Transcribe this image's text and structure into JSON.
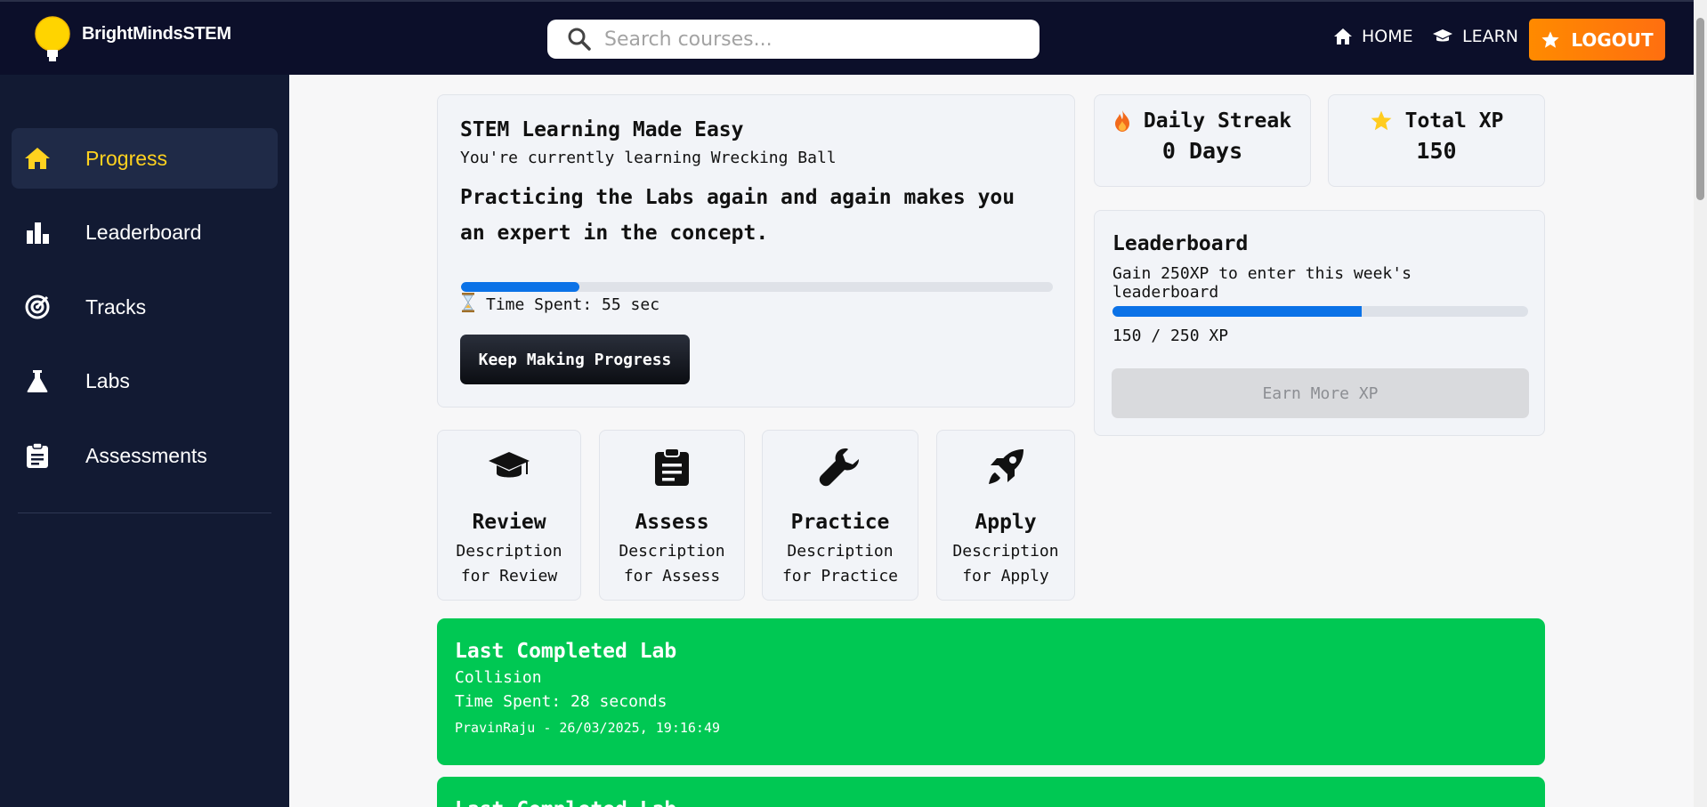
{
  "header": {
    "brand": "BrightMindsSTEM",
    "search_placeholder": "Search courses...",
    "nav": {
      "home": "HOME",
      "learn": "LEARN",
      "logout": "LOGOUT"
    },
    "accent_logout": "#ff7a0a"
  },
  "sidebar": {
    "items": [
      {
        "label": "Progress",
        "icon": "home-icon",
        "active": true
      },
      {
        "label": "Leaderboard",
        "icon": "bar-chart-icon",
        "active": false
      },
      {
        "label": "Tracks",
        "icon": "target-icon",
        "active": false
      },
      {
        "label": "Labs",
        "icon": "flask-icon",
        "active": false
      },
      {
        "label": "Assessments",
        "icon": "clipboard-icon",
        "active": false
      }
    ]
  },
  "hero": {
    "title": "STEM Learning Made Easy",
    "subtitle": "You're currently learning Wrecking Ball",
    "quote": "Practicing the Labs again and again makes you an expert in the concept.",
    "progress_fraction": 0.2,
    "time_spent": "Time Spent: 55 sec",
    "button": "Keep Making Progress"
  },
  "stats": {
    "streak_title": "Daily Streak",
    "streak_value": "0 Days",
    "xp_title": "Total XP",
    "xp_value": "150"
  },
  "leaderboard": {
    "title": "Leaderboard",
    "subtitle": "Gain 250XP to enter this week's leaderboard",
    "current_xp": 150,
    "target_xp": 250,
    "count_text": "150 / 250 XP",
    "button": "Earn More XP"
  },
  "tiles": [
    {
      "title": "Review",
      "desc": "Description for Review",
      "icon": "graduation-cap-icon"
    },
    {
      "title": "Assess",
      "desc": "Description for Assess",
      "icon": "clipboard-icon"
    },
    {
      "title": "Practice",
      "desc": "Description for Practice",
      "icon": "wrench-icon"
    },
    {
      "title": "Apply",
      "desc": "Description for Apply",
      "icon": "rocket-icon"
    }
  ],
  "labs": [
    {
      "title": "Last Completed Lab",
      "name": "Collision",
      "time": "Time Spent: 28 seconds",
      "meta": "PravinRaju - 26/03/2025, 19:16:49"
    },
    {
      "title": "Last Completed Lab"
    }
  ],
  "colors": {
    "topbar": "#0c0f2a",
    "sidebar": "#121a33",
    "active_text": "#ffd21f",
    "progress": "#0b72e7",
    "lab_green": "#00c853"
  }
}
